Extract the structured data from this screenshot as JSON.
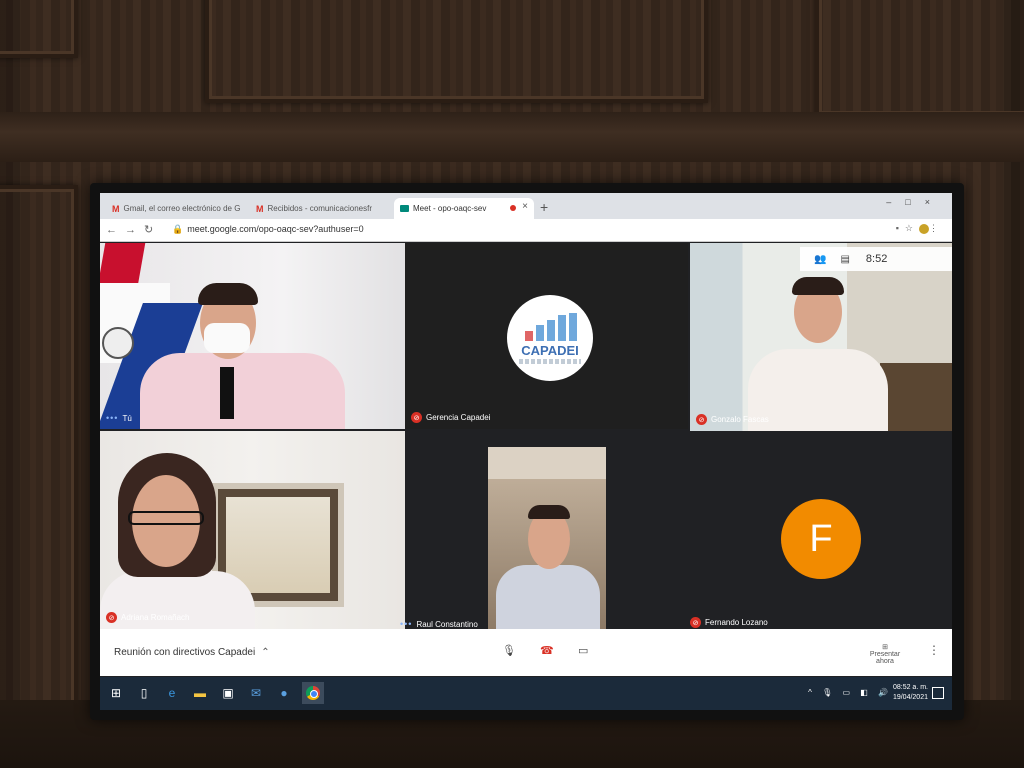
{
  "browser": {
    "tabs": [
      {
        "label": "Gmail, el correo electrónico de G"
      },
      {
        "label": "Recibidos - comunicacionesfr"
      },
      {
        "label": "Meet - opo-oaqc-sev"
      }
    ],
    "url": "meet.google.com/opo-oaqc-sev?authuser=0"
  },
  "meet": {
    "clock": "8:52",
    "participants": [
      {
        "name": "Tú"
      },
      {
        "name": "Gerencia Capadei"
      },
      {
        "name": "Gonzalo Fascas"
      },
      {
        "name": "Adriana Romañach"
      },
      {
        "name": "Raul Constantino"
      },
      {
        "name": "Fernando Lozano"
      }
    ],
    "logo_text": "CAPADEI",
    "avatar_letter": "F",
    "meeting_title": "Reunión con directivos Capadei",
    "present_label": "Presentar ahora"
  },
  "taskbar": {
    "time": "08:52 a. m.",
    "date": "19/04/2021"
  },
  "colors": {
    "mic_off": "#d93025",
    "avatar_bg": "#f28b00",
    "meet_bg": "#202124"
  }
}
